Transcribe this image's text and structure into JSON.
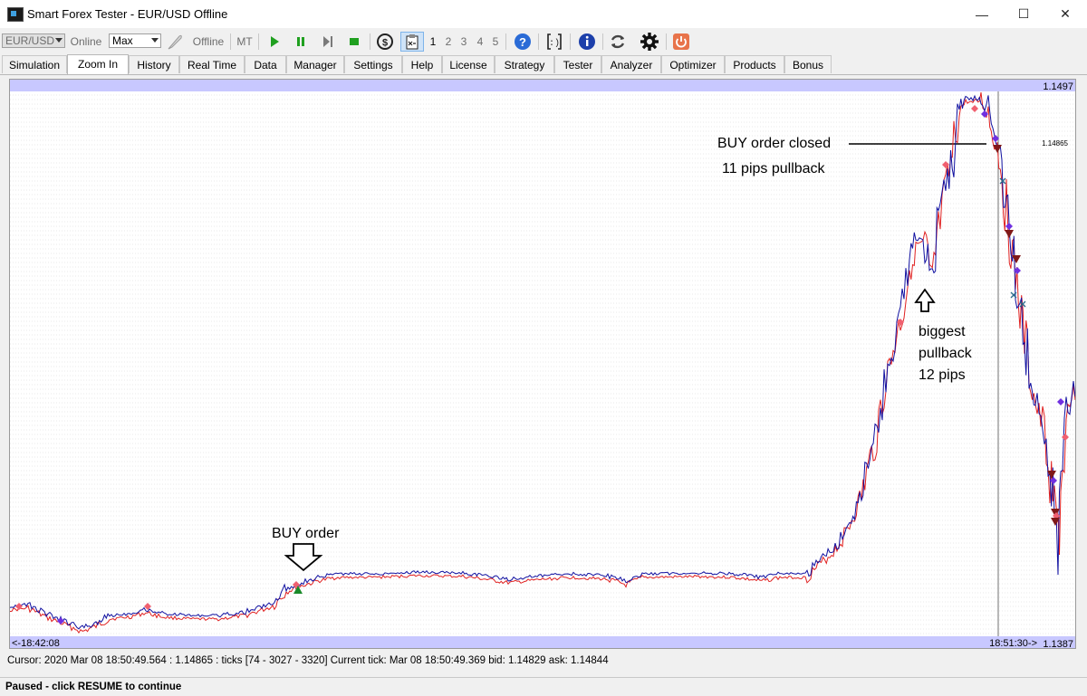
{
  "window": {
    "title": "Smart Forex Tester - EUR/USD Offline",
    "minimize": "—",
    "maximize": "☐",
    "close": "✕"
  },
  "toolbar": {
    "symbol": "EUR/USD",
    "online_label": "Online",
    "speed": "Max",
    "offline_label": "Offline",
    "mt_label": "MT",
    "speed_steps": [
      "1",
      "2",
      "3",
      "4",
      "5"
    ]
  },
  "tabs": [
    "Simulation",
    "Zoom In",
    "History",
    "Real Time",
    "Data",
    "Manager",
    "Settings",
    "Help",
    "License",
    "Strategy",
    "Tester",
    "Analyzer",
    "Optimizer",
    "Products",
    "Bonus"
  ],
  "active_tab": "Zoom In",
  "chart": {
    "price_top": "1.1497",
    "price_bottom": "1.1387",
    "price_marker": "1.14865",
    "time_left": "<-18:42:08",
    "time_right": "18:51:30->",
    "annotation_buy": "BUY order",
    "annotation_closed_1": "BUY order closed",
    "annotation_closed_2": "11 pips pullback",
    "annotation_pullback_1": "biggest",
    "annotation_pullback_2": "pullback",
    "annotation_pullback_3": "12 pips"
  },
  "status": {
    "cursor_line": "Cursor: 2020 Mar 08 18:50:49.564 : 1.14865 :  ticks [74 - 3027 - 3320]    Current tick: Mar 08 18:50:49.369 bid: 1.14829 ask: 1.14844",
    "paused_line": "Paused - click RESUME to continue"
  },
  "colors": {
    "bid_line": "#e02020",
    "ask_line": "#1010a0",
    "header_band": "#c8c8ff",
    "active_step": "#cfe3f7"
  }
}
